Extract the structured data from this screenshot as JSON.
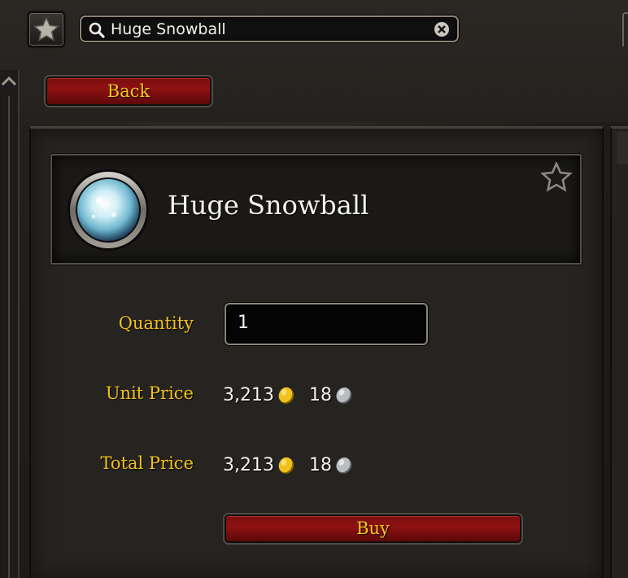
{
  "search": {
    "value": "Huge Snowball"
  },
  "navigation": {
    "back_label": "Back"
  },
  "item": {
    "name": "Huge Snowball",
    "icon": "snowball-icon"
  },
  "purchase": {
    "quantity_label": "Quantity",
    "quantity_value": "1",
    "unit_price_label": "Unit Price",
    "unit_price_gold": "3,213",
    "unit_price_silver": "18",
    "total_price_label": "Total Price",
    "total_price_gold": "3,213",
    "total_price_silver": "18",
    "buy_label": "Buy"
  },
  "colors": {
    "label_gold": "#f5c11d",
    "button_red": "#8f1212",
    "panel_bg": "#262421",
    "text_white": "#f4f2ec"
  }
}
